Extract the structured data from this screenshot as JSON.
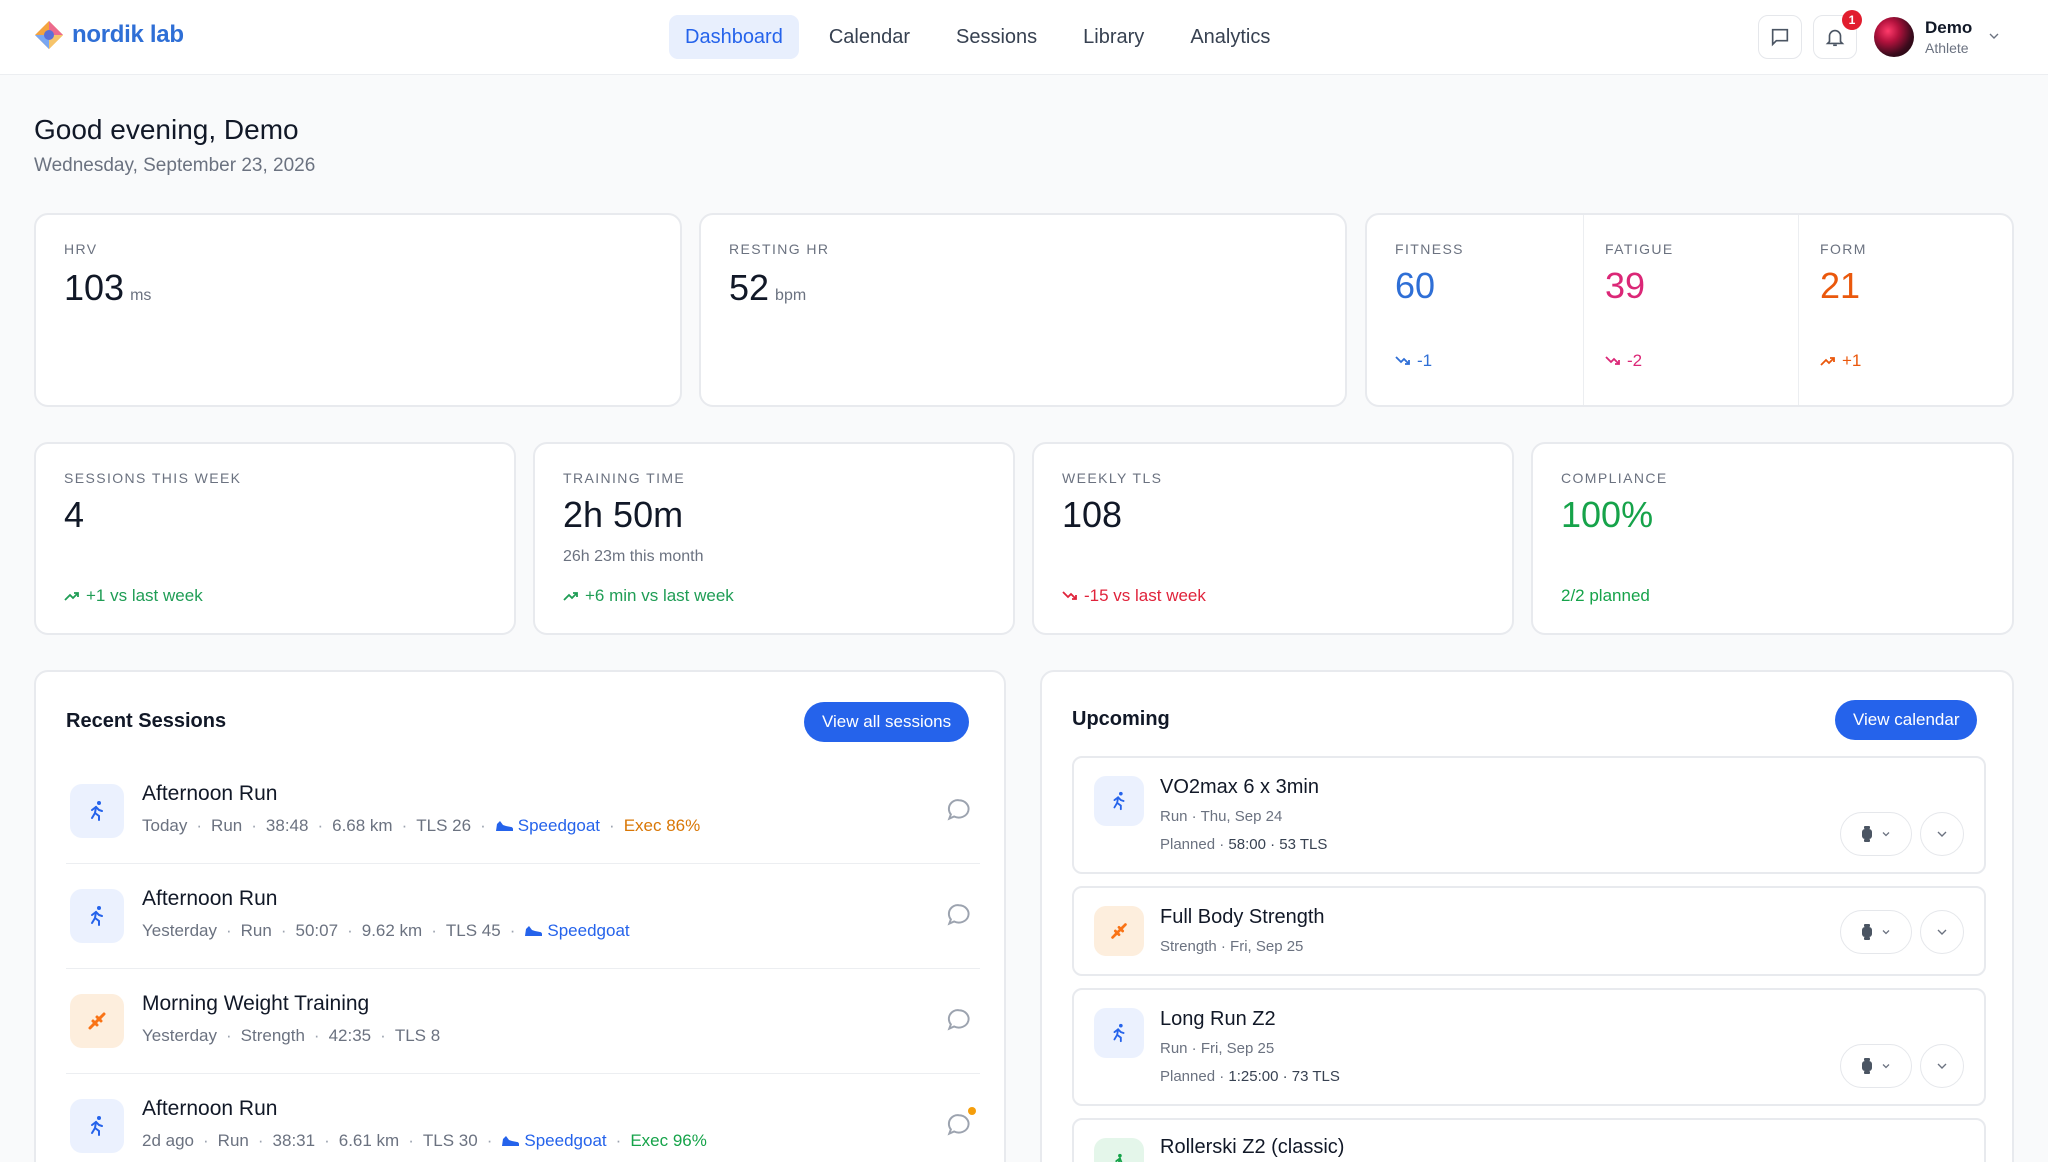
{
  "app": {
    "name": "nordik lab"
  },
  "nav": [
    {
      "label": "Dashboard",
      "active": true
    },
    {
      "label": "Calendar"
    },
    {
      "label": "Sessions"
    },
    {
      "label": "Library"
    },
    {
      "label": "Analytics"
    }
  ],
  "header": {
    "notification_count": "1",
    "user": {
      "name": "Demo",
      "role": "Athlete"
    }
  },
  "greeting": {
    "title": "Good evening, Demo",
    "date": "Wednesday, September 23, 2026"
  },
  "vitals": {
    "hrv": {
      "label": "HRV",
      "value": "103",
      "unit": "ms"
    },
    "resting_hr": {
      "label": "RESTING HR",
      "value": "52",
      "unit": "bpm"
    }
  },
  "load": {
    "fitness": {
      "label": "FITNESS",
      "value": "60",
      "trend": "-1",
      "color": "#2f6fd6"
    },
    "fatigue": {
      "label": "FATIGUE",
      "value": "39",
      "trend": "-2",
      "color": "#db2777"
    },
    "form": {
      "label": "FORM",
      "value": "21",
      "trend": "+1",
      "color": "#ea580c"
    }
  },
  "week": {
    "sessions": {
      "label": "SESSIONS THIS WEEK",
      "value": "4",
      "trend": "+1 vs last week"
    },
    "time": {
      "label": "TRAINING TIME",
      "value": "2h 50m",
      "sub": "26h 23m this month",
      "trend": "+6 min vs last week"
    },
    "tls": {
      "label": "WEEKLY TLS",
      "value": "108",
      "trend": "-15 vs last week"
    },
    "compliance": {
      "label": "COMPLIANCE",
      "value": "100%",
      "sub": "2/2 planned",
      "color": "#16a34a"
    }
  },
  "recent": {
    "title": "Recent Sessions",
    "button": "View all sessions",
    "items": [
      {
        "title": "Afternoon Run",
        "when": "Today",
        "sport": "Run",
        "duration": "38:48",
        "distance": "6.68 km",
        "tls": "TLS 26",
        "shoe": "Speedgoat",
        "exec": "Exec 86%"
      },
      {
        "title": "Afternoon Run",
        "when": "Yesterday",
        "sport": "Run",
        "duration": "50:07",
        "distance": "9.62 km",
        "tls": "TLS 45",
        "shoe": "Speedgoat"
      },
      {
        "title": "Morning Weight Training",
        "when": "Yesterday",
        "sport": "Strength",
        "duration": "42:35",
        "tls": "TLS 8"
      },
      {
        "title": "Afternoon Run",
        "when": "2d ago",
        "sport": "Run",
        "duration": "38:31",
        "distance": "6.61 km",
        "tls": "TLS 30",
        "shoe": "Speedgoat",
        "exec": "Exec 96%"
      }
    ]
  },
  "upcoming": {
    "title": "Upcoming",
    "button": "View calendar",
    "items": [
      {
        "title": "VO2max 6 x 3min",
        "sub": "Run · Thu, Sep 24",
        "plan_label": "Planned ·",
        "plan_value": "58:00 · 53 TLS"
      },
      {
        "title": "Full Body Strength",
        "sub": "Strength · Fri, Sep 25"
      },
      {
        "title": "Long Run Z2",
        "sub": "Run · Fri, Sep 25",
        "plan_label": "Planned ·",
        "plan_value": "1:25:00 · 73 TLS"
      },
      {
        "title": "Rollerski Z2 (classic)"
      }
    ]
  },
  "icons": {
    "run": "running-person-icon",
    "strength": "dumbbell-icon",
    "ski": "skier-icon",
    "comment": "comment-icon",
    "shoe": "shoe-icon",
    "watch": "watch-icon"
  },
  "colors": {
    "accent": "#2563eb",
    "up": "#16a34a",
    "down": "#e0233b"
  }
}
